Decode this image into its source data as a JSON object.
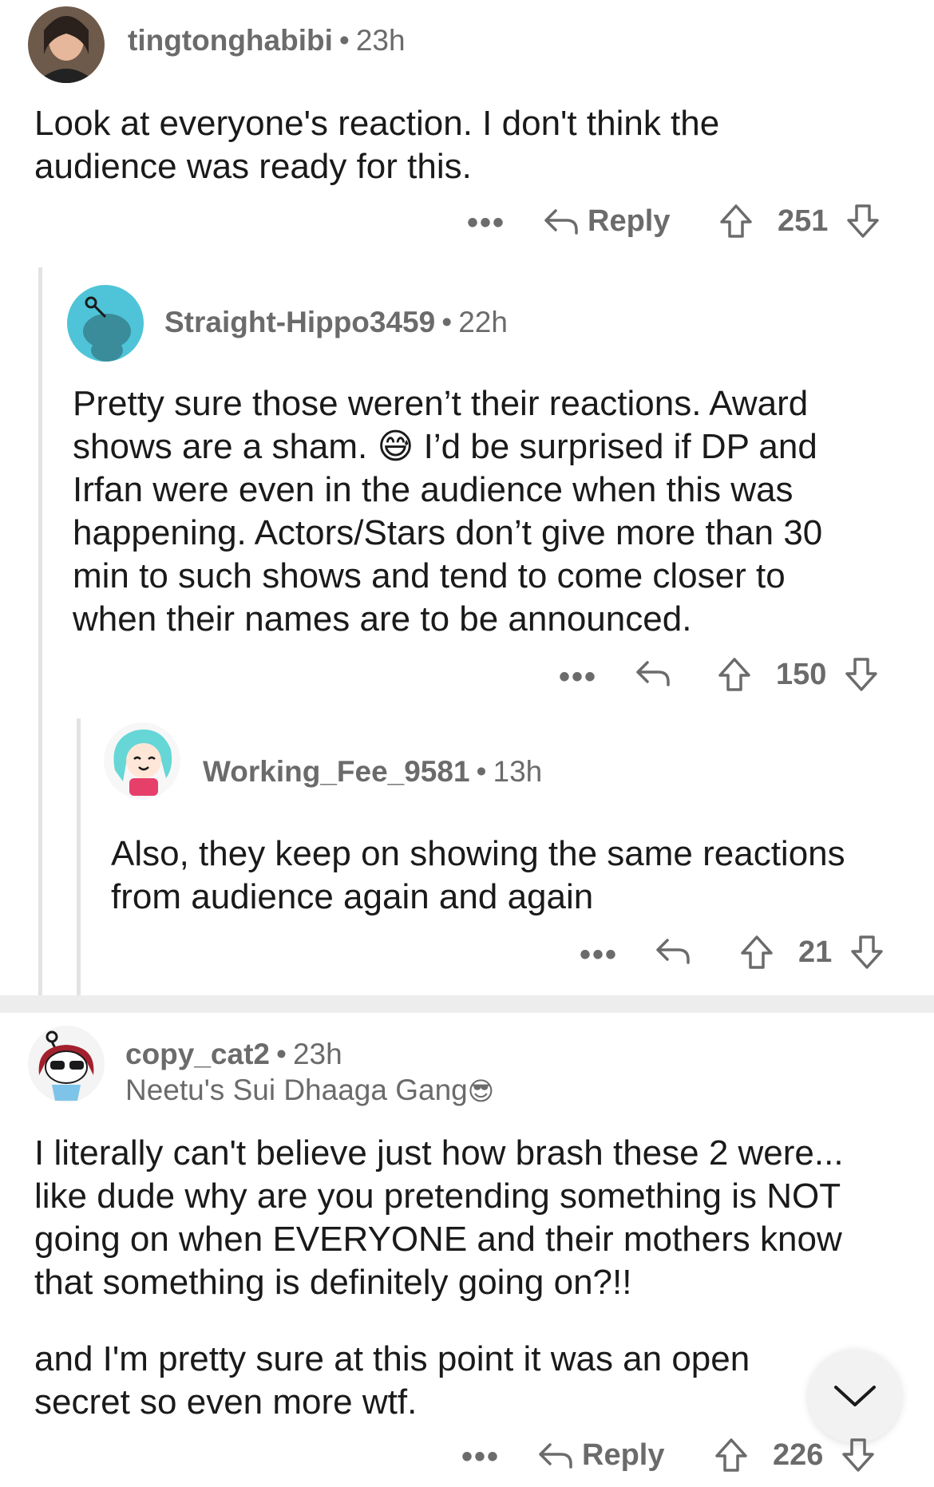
{
  "comments": [
    {
      "username": "tingtonghabibi",
      "time": "23h",
      "body": [
        "Look at everyone's reaction. I don't think the",
        "audience was ready for this."
      ],
      "reply_label": "Reply",
      "score": "251",
      "avatar_icon": "user-photo-avatar"
    },
    {
      "username": "Straight-Hippo3459",
      "time": "22h",
      "body_line1_before_emoji": "shows are a sham. ",
      "body": [
        "Pretty sure those weren’t their reactions. Award",
        "I’d be surprised if DP and",
        "Irfan were even in the audience when this was",
        "happening. Actors/Stars don’t give more than 30",
        "min to such shows and tend to come closer to",
        "when their names are to be announced."
      ],
      "emoji": "😅",
      "score": "150",
      "avatar_icon": "snoo-avatar"
    },
    {
      "username": "Working_Fee_9581",
      "time": "13h",
      "body": [
        "Also, they keep on showing the same reactions",
        "from audience again and again"
      ],
      "score": "21",
      "avatar_icon": "cartoon-avatar"
    },
    {
      "username": "copy_cat2",
      "time": "23h",
      "flair": "Neetu's Sui Dhaaga Gang",
      "flair_emoji": "😎",
      "body": [
        "I literally can't believe just how brash these 2 were...",
        "like dude why are you pretending something is NOT",
        "going on when EVERYONE and their mothers know",
        "that something is definitely going on?!!"
      ],
      "body2": [
        "and I'm pretty sure at this point it was an open",
        "secret so even more wtf."
      ],
      "reply_label": "Reply",
      "score": "226",
      "avatar_icon": "snoo-sunglasses-avatar"
    }
  ],
  "ui": {
    "more_label": "•••",
    "scroll_icon": "chevron-down-icon"
  }
}
